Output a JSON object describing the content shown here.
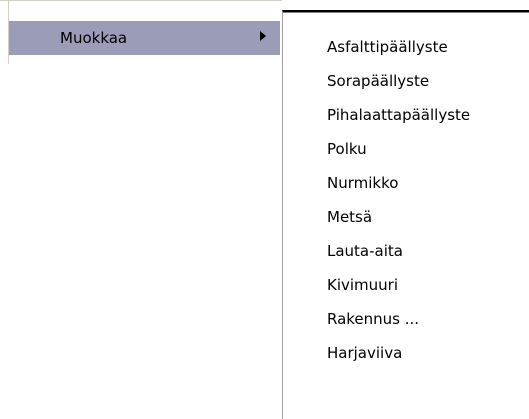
{
  "parent_menu": {
    "selected_item": {
      "label": "Muokkaa",
      "arrow_icon": "submenu-arrow-icon",
      "highlight_color": "#9a9cb8"
    }
  },
  "submenu": {
    "items": [
      {
        "label": "Asfalttipäällyste"
      },
      {
        "label": "Sorapäällyste"
      },
      {
        "label": "Pihalaattapäällyste"
      },
      {
        "label": "Polku"
      },
      {
        "label": "Nurmikko"
      },
      {
        "label": "Metsä"
      },
      {
        "label": "Lauta-aita"
      },
      {
        "label": "Kivimuuri"
      },
      {
        "label": "Rakennus ..."
      },
      {
        "label": "Harjaviiva"
      }
    ]
  }
}
